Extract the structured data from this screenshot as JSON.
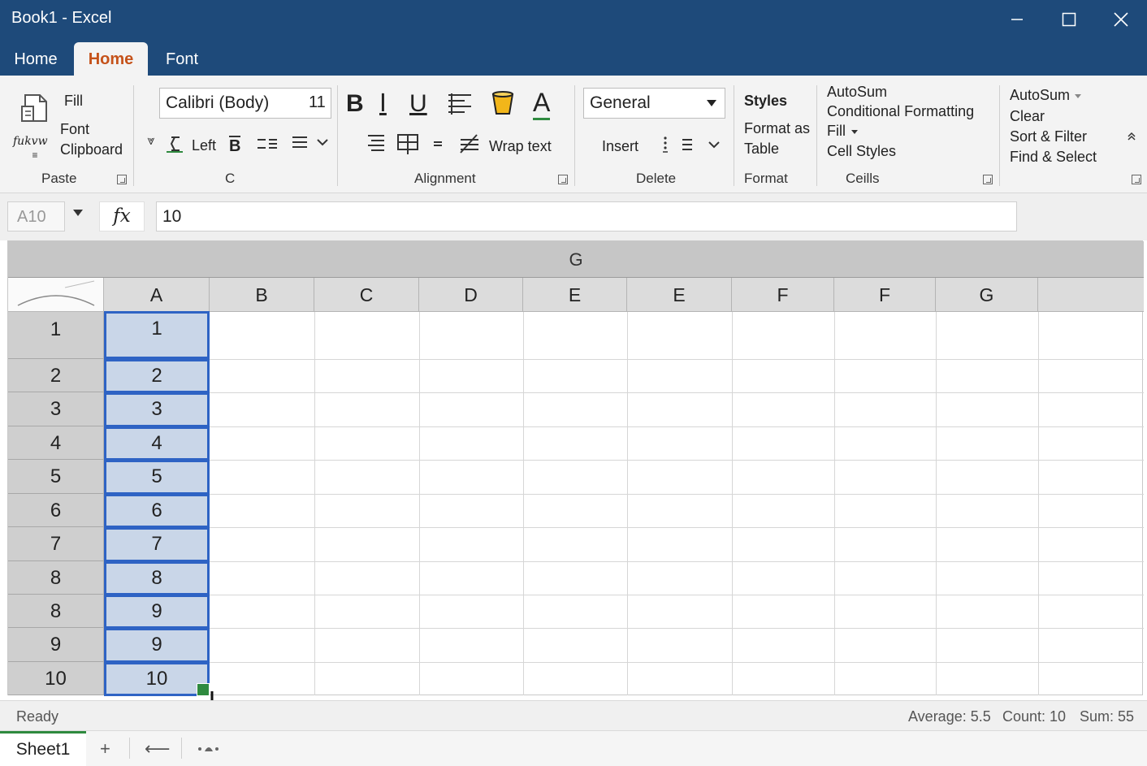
{
  "window": {
    "title": "Book1 - Excel",
    "controls": [
      "minimize-icon",
      "maximize-icon",
      "close-icon"
    ]
  },
  "tabs": [
    {
      "label": "Home",
      "active": false
    },
    {
      "label": "Home",
      "active": true
    },
    {
      "label": "Font",
      "active": false
    }
  ],
  "ribbon": {
    "clipboard": {
      "fill": "Fill",
      "font": "Font",
      "clipboard": "Clipboard",
      "paste_glyph_text": "fukvw",
      "group_label": "Paste"
    },
    "font": {
      "font_name": "Calibri (Body)",
      "font_size": "11",
      "bold": "B",
      "italic": "I",
      "underline": "U",
      "font_color_glyph": "A",
      "align_left_label": "Left",
      "border_glyph": "B",
      "group_label": "C"
    },
    "alignment": {
      "wrap_text": "Wrap text",
      "group_label": "Alignment"
    },
    "number": {
      "format": "General",
      "insert": "Insert",
      "group_label": "Delete"
    },
    "styles": {
      "styles": "Styles",
      "format_as_table": [
        "Format as",
        "Table"
      ],
      "group_label": "Format"
    },
    "cells": {
      "items": [
        "AutoSum",
        "Conditional Formatting",
        "Fill",
        "Cell Styles"
      ],
      "group_label": "Ceills"
    },
    "editing": {
      "items": [
        "AutoSum",
        "Clear",
        "Sort & Filter",
        "Find & Select"
      ]
    }
  },
  "formula_bar": {
    "name_box": "A10",
    "fx": "fx",
    "value": "10"
  },
  "sheet": {
    "group_header": "G",
    "columns": [
      "A",
      "B",
      "C",
      "D",
      "E",
      "E",
      "F",
      "F",
      "G",
      ""
    ],
    "row_headers": [
      "1",
      "2",
      "3",
      "4",
      "5",
      "6",
      "7",
      "8",
      "8",
      "9",
      "10"
    ],
    "column_a_values": [
      "1",
      "2",
      "3",
      "4",
      "5",
      "6",
      "7",
      "8",
      "9",
      "9",
      "10"
    ]
  },
  "status_bar": {
    "ready": "Ready",
    "average": "Average: 5.5",
    "count": "Count: 10",
    "sum": "Sum: 55"
  },
  "sheet_tabs": {
    "active": "Sheet1",
    "add": "+",
    "nav": "⟵"
  },
  "colors": {
    "title_bar": "#1e4a7a",
    "active_tab_text": "#c5521a",
    "selection_border": "#2e63c4",
    "selection_fill": "#c9d6e8",
    "fill_handle": "#2f8a3f"
  }
}
